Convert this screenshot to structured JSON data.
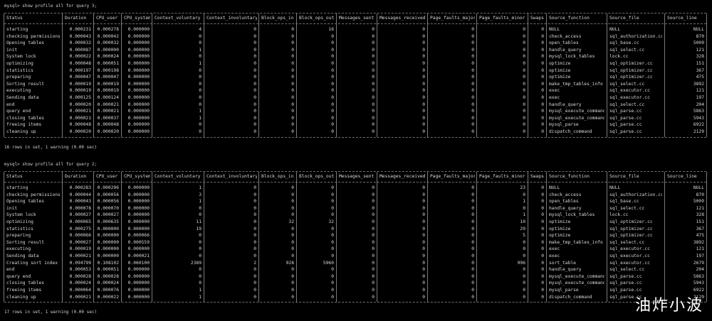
{
  "colors": {
    "background": "#000000",
    "text": "#d8d8d8",
    "border": "#7a7a7a",
    "watermark": "#ffffff"
  },
  "headers": [
    "Status",
    "Duration",
    "CPU_user",
    "CPU_system",
    "Context_voluntary",
    "Context_involuntary",
    "Block_ops_in",
    "Block_ops_out",
    "Messages_sent",
    "Messages_received",
    "Page_faults_major",
    "Page_faults_minor",
    "Swaps",
    "Source_function",
    "Source_file",
    "Source_line"
  ],
  "queries": [
    {
      "prompt": "mysql> show profile all for query 3;",
      "summary": "16 rows in set, 1 warning (0.00 sec)",
      "rows": [
        [
          "starting",
          "0.000231",
          "0.000278",
          "0.000000",
          "4",
          "0",
          "0",
          "16",
          "0",
          "0",
          "0",
          "0",
          "0",
          "NULL",
          "NULL",
          "NULL"
        ],
        [
          "checking permissions",
          "0.000043",
          "0.000042",
          "0.000000",
          "0",
          "0",
          "0",
          "0",
          "0",
          "0",
          "0",
          "0",
          "0",
          "check_access",
          "sql_authorization.cc",
          "870"
        ],
        [
          "Opening tables",
          "0.000032",
          "0.000032",
          "0.000000",
          "0",
          "0",
          "0",
          "0",
          "0",
          "0",
          "0",
          "0",
          "0",
          "open_tables",
          "sql_base.cc",
          "5009"
        ],
        [
          "init",
          "0.000087",
          "0.000000",
          "0.000000",
          "1",
          "0",
          "0",
          "0",
          "0",
          "0",
          "0",
          "0",
          "0",
          "handle_query",
          "sql_select.cc",
          "121"
        ],
        [
          "System lock",
          "0.000022",
          "0.000024",
          "0.000000",
          "0",
          "0",
          "0",
          "0",
          "0",
          "0",
          "0",
          "0",
          "0",
          "mysql_lock_tables",
          "lock.cc",
          "328"
        ],
        [
          "optimizing",
          "0.000048",
          "0.000051",
          "0.000000",
          "1",
          "0",
          "0",
          "0",
          "0",
          "0",
          "0",
          "0",
          "0",
          "optimize",
          "sql_optimizer.cc",
          "151"
        ],
        [
          "statistics",
          "0.000197",
          "0.000198",
          "0.000000",
          "0",
          "0",
          "0",
          "0",
          "0",
          "0",
          "0",
          "0",
          "0",
          "optimize",
          "sql_optimizer.cc",
          "367"
        ],
        [
          "preparing",
          "0.000047",
          "0.000047",
          "0.000000",
          "0",
          "0",
          "0",
          "0",
          "0",
          "0",
          "0",
          "0",
          "0",
          "optimize",
          "sql_optimizer.cc",
          "475"
        ],
        [
          "Sorting result",
          "0.000019",
          "0.000019",
          "0.000000",
          "0",
          "0",
          "0",
          "0",
          "0",
          "0",
          "0",
          "0",
          "0",
          "make_tmp_tables_info",
          "sql_select.cc",
          "3892"
        ],
        [
          "executing",
          "0.000019",
          "0.000019",
          "0.000000",
          "0",
          "0",
          "0",
          "0",
          "0",
          "0",
          "0",
          "0",
          "0",
          "exec",
          "sql_executor.cc",
          "121"
        ],
        [
          "Sending data",
          "0.000125",
          "0.000124",
          "0.000000",
          "0",
          "0",
          "0",
          "0",
          "0",
          "0",
          "0",
          "0",
          "0",
          "exec",
          "sql_executor.cc",
          "197"
        ],
        [
          "end",
          "0.000020",
          "0.000021",
          "0.000000",
          "0",
          "0",
          "0",
          "0",
          "0",
          "0",
          "0",
          "0",
          "0",
          "handle_query",
          "sql_select.cc",
          "204"
        ],
        [
          "query end",
          "0.000021",
          "0.000021",
          "0.000000",
          "1",
          "0",
          "0",
          "0",
          "0",
          "0",
          "0",
          "0",
          "0",
          "mysql_execute_command",
          "sql_parse.cc",
          "5863"
        ],
        [
          "closing tables",
          "0.000021",
          "0.000037",
          "0.000000",
          "1",
          "0",
          "0",
          "0",
          "0",
          "0",
          "0",
          "0",
          "0",
          "mysql_execute_command",
          "sql_parse.cc",
          "5943"
        ],
        [
          "freeing items",
          "0.000048",
          "0.000048",
          "0.000000",
          "0",
          "0",
          "0",
          "0",
          "0",
          "0",
          "0",
          "0",
          "0",
          "mysql_parse",
          "sql_parse.cc",
          "6922"
        ],
        [
          "cleaning up",
          "0.000020",
          "0.000020",
          "0.000000",
          "0",
          "0",
          "0",
          "0",
          "0",
          "0",
          "0",
          "0",
          "0",
          "dispatch_command",
          "sql_parse.cc",
          "2129"
        ]
      ]
    },
    {
      "prompt": "mysql> show profile all for query 2;",
      "summary": "17 rows in set, 1 warning (0.00 sec)",
      "rows": [
        [
          "starting",
          "0.000283",
          "0.000296",
          "0.000000",
          "1",
          "0",
          "0",
          "0",
          "0",
          "0",
          "0",
          "23",
          "0",
          "NULL",
          "NULL",
          "NULL"
        ],
        [
          "checking permissions",
          "0.000044",
          "0.000056",
          "0.000000",
          "3",
          "0",
          "0",
          "0",
          "0",
          "0",
          "0",
          "0",
          "0",
          "check_access",
          "sql_authorization.cc",
          "870"
        ],
        [
          "Opening tables",
          "0.000043",
          "0.000056",
          "0.000000",
          "1",
          "0",
          "0",
          "0",
          "0",
          "0",
          "0",
          "1",
          "0",
          "open_tables",
          "sql_base.cc",
          "5009"
        ],
        [
          "init",
          "0.000078",
          "0.000070",
          "0.000000",
          "0",
          "0",
          "0",
          "0",
          "0",
          "0",
          "0",
          "0",
          "0",
          "handle_query",
          "sql_select.cc",
          "121"
        ],
        [
          "System lock",
          "0.000027",
          "0.000027",
          "0.000000",
          "0",
          "0",
          "0",
          "0",
          "0",
          "0",
          "0",
          "1",
          "0",
          "mysql_lock_tables",
          "lock.cc",
          "328"
        ],
        [
          "optimizing",
          "0.000065",
          "0.000635",
          "0.000000",
          "11",
          "0",
          "32",
          "32",
          "0",
          "0",
          "0",
          "10",
          "0",
          "optimize",
          "sql_optimizer.cc",
          "151"
        ],
        [
          "statistics",
          "0.000275",
          "0.000000",
          "0.000000",
          "19",
          "0",
          "0",
          "0",
          "0",
          "0",
          "0",
          "29",
          "0",
          "optimize",
          "sql_optimizer.cc",
          "367"
        ],
        [
          "preparing",
          "0.000066",
          "0.000000",
          "0.000066",
          "0",
          "0",
          "0",
          "0",
          "0",
          "0",
          "0",
          "5",
          "0",
          "optimize",
          "sql_optimizer.cc",
          "475"
        ],
        [
          "Sorting result",
          "0.000027",
          "0.000000",
          "0.000559",
          "0",
          "0",
          "0",
          "0",
          "0",
          "0",
          "0",
          "0",
          "0",
          "make_tmp_tables_info",
          "sql_select.cc",
          "3892"
        ],
        [
          "executing",
          "0.000019",
          "0.000000",
          "0.000000",
          "0",
          "0",
          "0",
          "0",
          "0",
          "0",
          "0",
          "0",
          "0",
          "exec",
          "sql_executor.cc",
          "121"
        ],
        [
          "Sending data",
          "0.000021",
          "0.000000",
          "0.000021",
          "0",
          "0",
          "0",
          "0",
          "0",
          "0",
          "0",
          "0",
          "0",
          "exec",
          "sql_executor.cc",
          "197"
        ],
        [
          "Creating sort index",
          "0.094799",
          "0.108102",
          "0.060100",
          "2389",
          "2",
          "928",
          "5960",
          "0",
          "0",
          "0",
          "996",
          "0",
          "sort_table",
          "sql_executor.cc",
          "2679"
        ],
        [
          "end",
          "0.000053",
          "0.000051",
          "0.000000",
          "0",
          "0",
          "0",
          "0",
          "0",
          "0",
          "0",
          "0",
          "0",
          "handle_query",
          "sql_select.cc",
          "204"
        ],
        [
          "query end",
          "0.000028",
          "0.000028",
          "0.000000",
          "0",
          "0",
          "0",
          "0",
          "0",
          "0",
          "0",
          "0",
          "0",
          "mysql_execute_command",
          "sql_parse.cc",
          "5863"
        ],
        [
          "closing tables",
          "0.000024",
          "0.000024",
          "0.000000",
          "0",
          "0",
          "0",
          "0",
          "0",
          "0",
          "0",
          "0",
          "0",
          "mysql_execute_command",
          "sql_parse.cc",
          "5943"
        ],
        [
          "freeing items",
          "0.000064",
          "0.000076",
          "0.000000",
          "1",
          "0",
          "0",
          "0",
          "0",
          "0",
          "0",
          "0",
          "0",
          "mysql_parse",
          "sql_parse.cc",
          "6922"
        ],
        [
          "cleaning up",
          "0.000021",
          "0.000022",
          "0.000000",
          "1",
          "0",
          "0",
          "0",
          "0",
          "0",
          "0",
          "0",
          "0",
          "dispatch_command",
          "sql_parse.cc",
          "2129"
        ]
      ]
    }
  ],
  "watermark": "油炸小波"
}
